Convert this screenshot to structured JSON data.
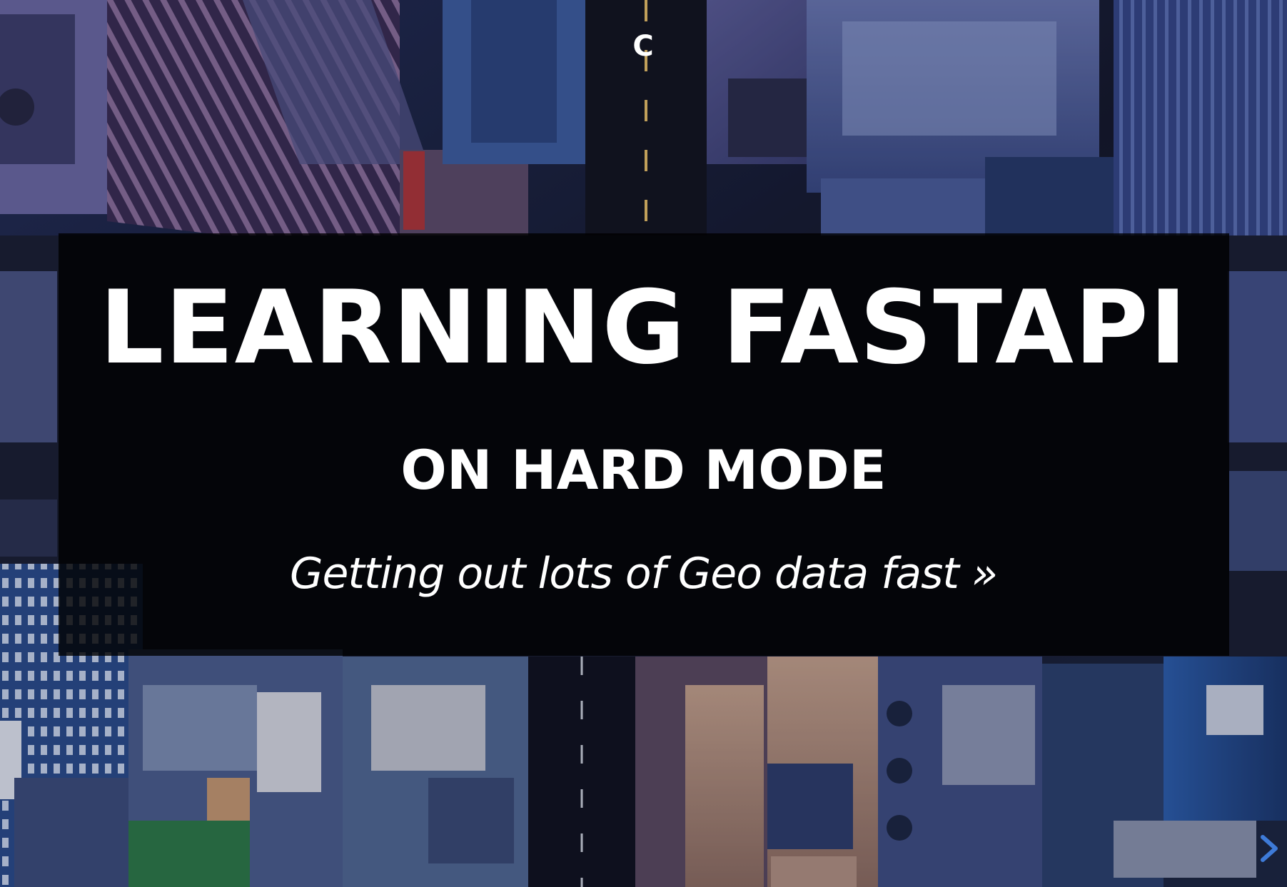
{
  "slide": {
    "top_letter": "C",
    "title": "LEARNING FASTAPI",
    "subtitle": "ON HARD MODE",
    "tagline": "Getting out lots of Geo data fast »"
  },
  "background": {
    "description_icon": "aerial-city-photo",
    "accent_color": "#2b5aa6"
  },
  "controls": {
    "next_icon": "chevron-right-icon",
    "arrow_color": "#3e7bd8"
  }
}
